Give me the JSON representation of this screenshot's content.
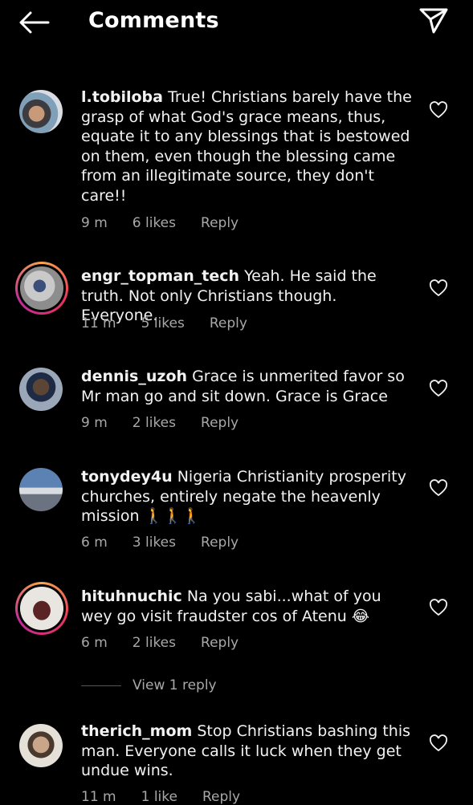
{
  "header": {
    "title": "Comments",
    "back_icon": "arrow-left-icon",
    "send_icon": "paper-plane-icon"
  },
  "comments": [
    {
      "username": "l.tobiloba",
      "text": "True! Christians barely have the grasp of what God's grace means, thus, equate it to any blessings that is bestowed on them, even though the blessing came from an illegitimate source, they don't care!!",
      "time": "9 m",
      "likes": "6 likes",
      "reply": "Reply",
      "story": false
    },
    {
      "username": "engr_topman_tech",
      "text": "Yeah. He said the truth. Not only Christians though. Everyone.",
      "time": "11 m",
      "likes": "5 likes",
      "reply": "Reply",
      "story": true
    },
    {
      "username": "dennis_uzoh",
      "text": "Grace is unmerited favor so Mr man go and sit down. Grace is Grace",
      "time": "9 m",
      "likes": "2 likes",
      "reply": "Reply",
      "story": false
    },
    {
      "username": "tonydey4u",
      "text": "Nigeria Christianity prosperity churches, entirely negate the heavenly mission 🚶🚶🚶",
      "time": "6 m",
      "likes": "3 likes",
      "reply": "Reply",
      "story": false
    },
    {
      "username": "hituhnuchic",
      "text": "Na you sabi...what of you wey go visit fraudster cos of Atenu 😂",
      "time": "6 m",
      "likes": "2 likes",
      "reply": "Reply",
      "story": true
    },
    {
      "username": "therich_mom",
      "text": "Stop Christians bashing this man. Everyone calls it luck when they get undue wins.",
      "time": "11 m",
      "likes": "1 like",
      "reply": "Reply",
      "story": false
    }
  ],
  "view_replies": "View 1 reply",
  "colors": {
    "background": "#000000",
    "text": "#f2f2f2",
    "muted": "#a8a8a8",
    "ring_start": "#f9a64a",
    "ring_end": "#c3299b"
  }
}
